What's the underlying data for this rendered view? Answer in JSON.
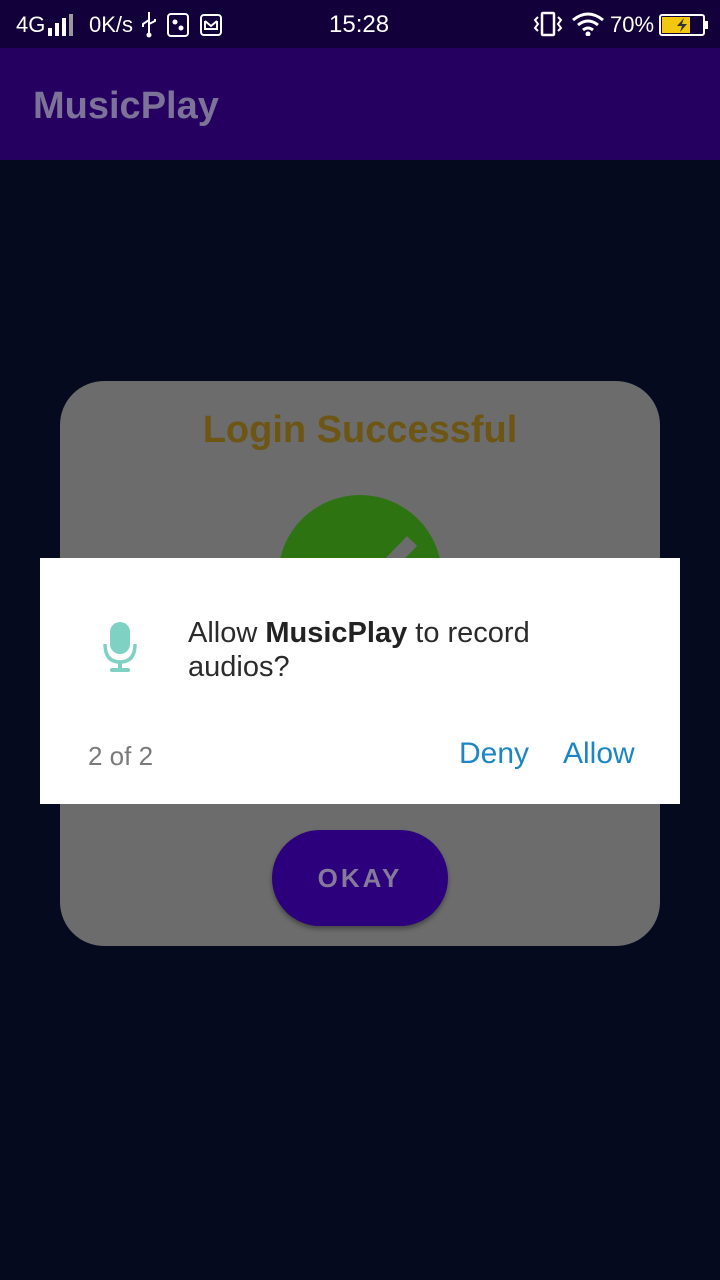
{
  "status_bar": {
    "network": "4G",
    "speed": "0K/s",
    "time": "15:28",
    "battery": "70%",
    "icons": [
      "signal-icon",
      "usb-icon",
      "sim-icon",
      "mail-icon",
      "vibrate-icon",
      "wifi-icon",
      "battery-icon"
    ],
    "battery_level": 0.7
  },
  "app_bar": {
    "title": "MusicPlay"
  },
  "login_dialog": {
    "title": "Login Successful",
    "icon": "check-icon",
    "okay_label": "OKAY"
  },
  "permission_dialog": {
    "icon": "microphone-icon",
    "prefix": "Allow ",
    "app_name": "MusicPlay",
    "suffix": " to record audios?",
    "counter": "2 of 2",
    "deny_label": "Deny",
    "allow_label": "Allow"
  },
  "colors": {
    "app_bar": "#260060",
    "accent": "#1c86c4",
    "success": "#2d7312",
    "title_gold": "#6d5514"
  }
}
